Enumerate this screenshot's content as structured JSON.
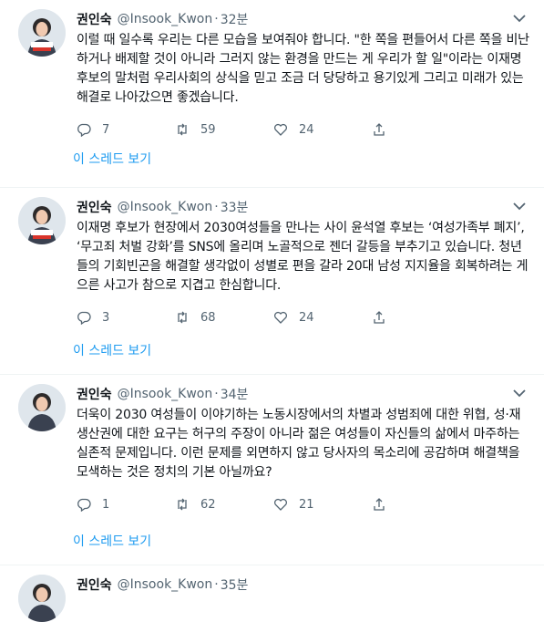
{
  "tweets": [
    {
      "name": "권인숙",
      "handle": "@Insook_Kwon",
      "separator": "·",
      "time": "32분",
      "text": "이럴 때 일수록 우리는 다른 모습을 보여줘야 합니다. \"한 쪽을 편들어서 다른 쪽을 비난하거나 배제할 것이 아니라 그러지 않는 환경을 만드는 게 우리가 할 일\"이라는 이재명 후보의 말처럼 우리사회의 상식을 믿고 조금 더 당당하고 용기있게 그리고 미래가 있는 해결로 나아갔으면 좋겠습니다.",
      "replies": "7",
      "retweets": "59",
      "likes": "24",
      "thread_label": "이 스레드 보기"
    },
    {
      "name": "권인숙",
      "handle": "@Insook_Kwon",
      "separator": "·",
      "time": "33분",
      "text": "이재명 후보가 현장에서 2030여성들을 만나는 사이 윤석열 후보는 ‘여성가족부 폐지’, ‘무고죄 처벌 강화’를 SNS에 올리며 노골적으로 젠더 갈등을 부추기고 있습니다. 청년들의 기회빈곤을 해결할 생각없이 성별로 편을 갈라 20대 남성 지지율을 회복하려는 게으른 사고가 참으로 지겹고 한심합니다.",
      "replies": "3",
      "retweets": "68",
      "likes": "24",
      "thread_label": "이 스레드 보기"
    },
    {
      "name": "권인숙",
      "handle": "@Insook_Kwon",
      "separator": "·",
      "time": "34분",
      "text": "더욱이 2030 여성들이 이야기하는 노동시장에서의 차별과 성범죄에 대한 위협, 성·재생산권에 대한 요구는 허구의 주장이 아니라 젊은 여성들이 자신들의 삶에서 마주하는 실존적 문제입니다. 이런 문제를 외면하지 않고 당사자의 목소리에 공감하며 해결책을 모색하는 것은 정치의 기본 아닐까요?",
      "replies": "1",
      "retweets": "62",
      "likes": "21",
      "thread_label": "이 스레드 보기"
    },
    {
      "name": "권인숙",
      "handle": "@Insook_Kwon",
      "separator": "·",
      "time": "35분"
    }
  ],
  "colors": {
    "link": "#1d9bf0",
    "muted": "#536471",
    "text": "#0f1419",
    "divider": "#eff3f4"
  },
  "icons": [
    "reply-icon",
    "retweet-icon",
    "like-icon",
    "share-icon",
    "more-caret-icon",
    "avatar"
  ]
}
